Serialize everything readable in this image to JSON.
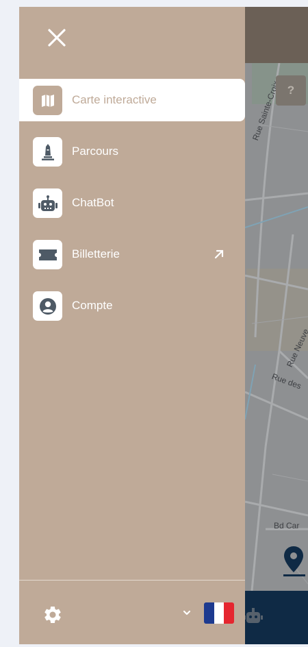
{
  "map": {
    "help_label": "?",
    "streets": [
      "Rue Sainte-Croix",
      "Rue Neuve",
      "Rue des",
      "Bd Car"
    ]
  },
  "drawer": {
    "menu": [
      {
        "label": "Carte interactive",
        "icon": "map-icon",
        "active": true
      },
      {
        "label": "Parcours",
        "icon": "monument-icon",
        "active": false
      },
      {
        "label": "ChatBot",
        "icon": "robot-icon",
        "active": false
      },
      {
        "label": "Billetterie",
        "icon": "ticket-icon",
        "active": false,
        "external": true
      },
      {
        "label": "Compte",
        "icon": "account-icon",
        "active": false
      }
    ],
    "footer": {
      "language": "fr",
      "flag_colors": [
        "#1d3a8f",
        "#ffffff",
        "#e5262f"
      ]
    }
  },
  "colors": {
    "drawer_bg": "#bfaa98",
    "active_item_bg": "#ffffff",
    "icon_fg": "#4e5a66",
    "bottom_bar": "#0f2a45"
  }
}
